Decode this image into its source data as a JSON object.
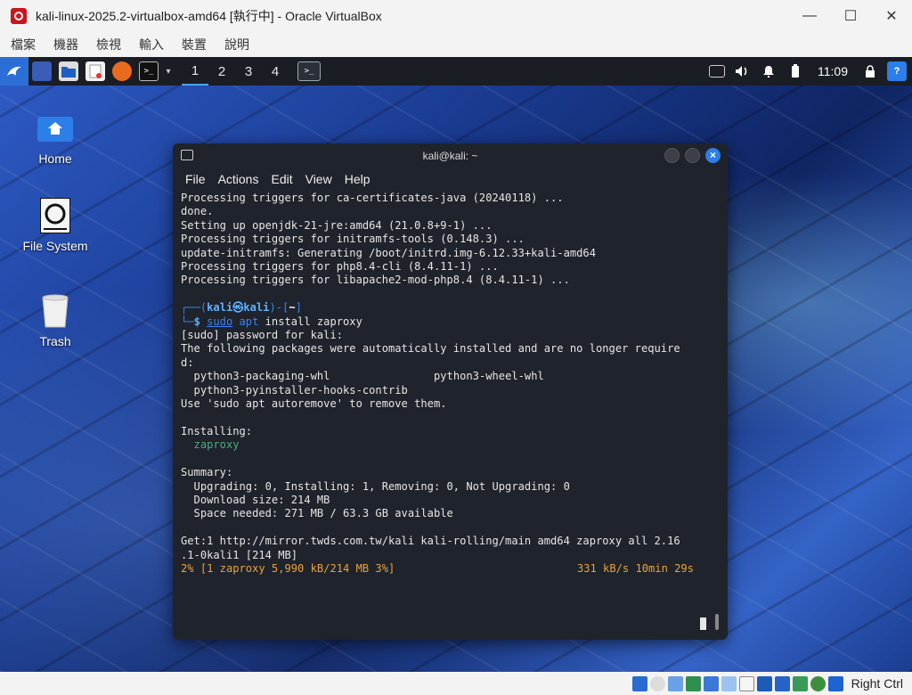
{
  "vbox": {
    "window_title": "kali-linux-2025.2-virtualbox-amd64 [執行中] - Oracle VirtualBox",
    "controls": {
      "minimize": "—",
      "maximize": "☐",
      "close": "✕"
    },
    "menu": [
      "檔案",
      "機器",
      "檢視",
      "輸入",
      "裝置",
      "說明"
    ],
    "host_key_label": "Right Ctrl"
  },
  "panel": {
    "workspaces": [
      "1",
      "2",
      "3",
      "4"
    ],
    "active_workspace": "1",
    "clock": "11:09"
  },
  "desktop": {
    "icons": [
      {
        "label": "Home",
        "icon": "home-folder-icon"
      },
      {
        "label": "File System",
        "icon": "drive-icon"
      },
      {
        "label": "Trash",
        "icon": "trash-icon"
      }
    ]
  },
  "terminal": {
    "title": "kali@kali: ~",
    "menu": [
      "File",
      "Actions",
      "Edit",
      "View",
      "Help"
    ],
    "lines": {
      "l1": "Processing triggers for ca-certificates-java (20240118) ...",
      "l2": "done.",
      "l3": "Setting up openjdk-21-jre:amd64 (21.0.8+9-1) ...",
      "l4": "Processing triggers for initramfs-tools (0.148.3) ...",
      "l5": "update-initramfs: Generating /boot/initrd.img-6.12.33+kali-amd64",
      "l6": "Processing triggers for php8.4-cli (8.4.11-1) ...",
      "l7": "Processing triggers for libapache2-mod-php8.4 (8.4.11-1) ...",
      "prompt_open": "┌──(",
      "prompt_user": "kali㉿kali",
      "prompt_mid": ")-[",
      "prompt_dir": "~",
      "prompt_close": "]",
      "prompt_line2": "└─",
      "prompt_dollar": "$",
      "cmd_sudo": "sudo",
      "cmd_apt": "apt",
      "cmd_rest": "install zaproxy",
      "l9": "[sudo] password for kali:",
      "l10": "The following packages were automatically installed and are no longer require",
      "l11": "d:",
      "l12a": "  python3-packaging-whl",
      "l12b": "python3-wheel-whl",
      "l13": "  python3-pyinstaller-hooks-contrib",
      "l14": "Use 'sudo apt autoremove' to remove them.",
      "l15": "Installing:",
      "l16": "  zaproxy",
      "l17": "Summary:",
      "l18": "  Upgrading: 0, Installing: 1, Removing: 0, Not Upgrading: 0",
      "l19": "  Download size: 214 MB",
      "l20": "  Space needed: 271 MB / 63.3 GB available",
      "l21": "Get:1 http://mirror.twds.com.tw/kali kali-rolling/main amd64 zaproxy all 2.16",
      "l22": ".1-0kali1 [214 MB]",
      "progress_left": "2% [1 zaproxy 5,990 kB/214 MB 3%]",
      "progress_right": "331 kB/s 10min 29s"
    }
  }
}
